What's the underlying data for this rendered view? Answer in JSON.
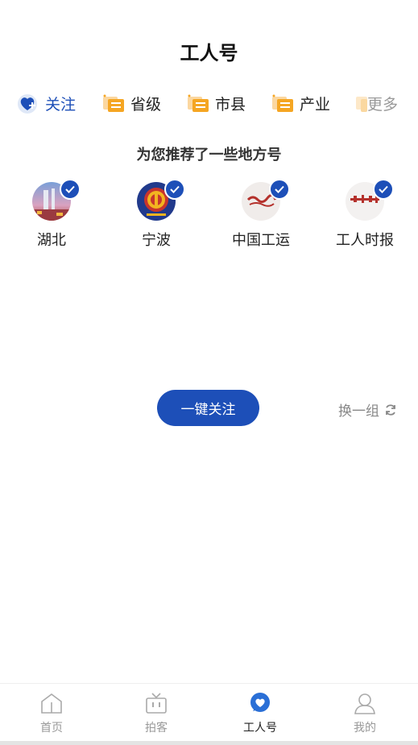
{
  "header": {
    "title": "工人号"
  },
  "tabs": [
    {
      "label": "关注",
      "icon": "heart-follow-icon",
      "active": true
    },
    {
      "label": "省级",
      "icon": "chat-card-icon"
    },
    {
      "label": "市县",
      "icon": "chat-card-icon"
    },
    {
      "label": "产业",
      "icon": "chat-card-icon"
    },
    {
      "label": "更多",
      "icon": "chat-card-icon"
    }
  ],
  "recommend": {
    "title": "为您推荐了一些地方号",
    "items": [
      {
        "name": "湖北"
      },
      {
        "name": "宁波"
      },
      {
        "name": "中国工运"
      },
      {
        "name": "工人时报"
      }
    ]
  },
  "actions": {
    "follow_all": "一键关注",
    "refresh": "换一组"
  },
  "bottom_nav": [
    {
      "label": "首页",
      "icon": "home-icon"
    },
    {
      "label": "拍客",
      "icon": "tv-icon"
    },
    {
      "label": "工人号",
      "icon": "heart-bubble-icon",
      "active": true
    },
    {
      "label": "我的",
      "icon": "user-icon"
    }
  ],
  "colors": {
    "accent": "#1d4fb8",
    "tab_icon": "#f5a623"
  }
}
